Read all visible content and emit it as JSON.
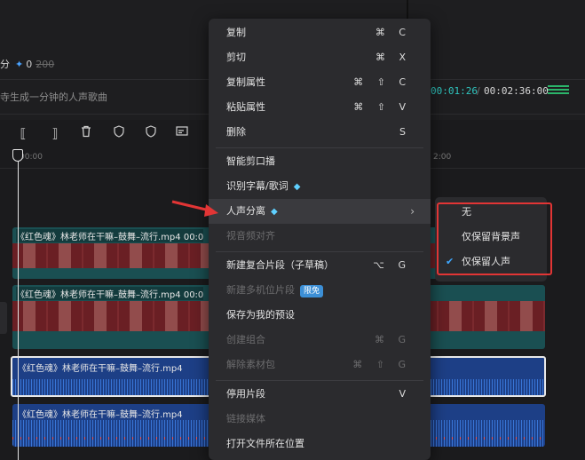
{
  "header": {
    "score_prefix": "分",
    "score_value": "0",
    "score_old": "200",
    "prompt_text": "寺生成一分钟的人声歌曲",
    "time_current": "00:01:26",
    "time_separator": "/",
    "time_total": "00:02:36:00"
  },
  "ruler": {
    "label_start": "00:00",
    "label_right": "2:00"
  },
  "tracks": {
    "video1_label": "《红色魂》林老师在干嘛–鼓舞–流行.mp4",
    "video1_time": "00:0",
    "video2_label": "《红色魂》林老师在干嘛–鼓舞–流行.mp4",
    "video2_time": "00:0",
    "audio1_label": "《红色魂》林老师在干嘛–鼓舞–流行.mp4",
    "audio2_label": "《红色魂》林老师在干嘛–鼓舞–流行.mp4"
  },
  "menu": {
    "items": [
      {
        "label": "复制",
        "shortcut": "⌘ C"
      },
      {
        "label": "剪切",
        "shortcut": "⌘ X"
      },
      {
        "label": "复制属性",
        "shortcut": "⌘ ⇧ C"
      },
      {
        "label": "粘贴属性",
        "shortcut": "⌘ ⇧ V"
      },
      {
        "label": "删除",
        "shortcut": "S"
      },
      {
        "label": "智能剪口播",
        "shortcut": ""
      },
      {
        "label": "识别字幕/歌词",
        "shortcut": ""
      },
      {
        "label": "人声分离",
        "shortcut": ""
      },
      {
        "label": "视音频对齐",
        "shortcut": ""
      },
      {
        "label": "新建复合片段（子草稿）",
        "shortcut": "⌥ G"
      },
      {
        "label": "新建多机位片段",
        "shortcut": "",
        "badge": "限免"
      },
      {
        "label": "保存为我的预设",
        "shortcut": ""
      },
      {
        "label": "创建组合",
        "shortcut": "⌘ G"
      },
      {
        "label": "解除素材包",
        "shortcut": "⌘ ⇧ G"
      },
      {
        "label": "停用片段",
        "shortcut": "V"
      },
      {
        "label": "链接媒体",
        "shortcut": ""
      },
      {
        "label": "打开文件所在位置",
        "shortcut": ""
      }
    ]
  },
  "submenu": {
    "items": [
      {
        "label": "无",
        "checked": false
      },
      {
        "label": "仅保留背景声",
        "checked": false
      },
      {
        "label": "仅保留人声",
        "checked": true
      }
    ],
    "check_mark": "✔"
  },
  "colors": {
    "accent": "#3ea7ff",
    "highlight": "#e23535",
    "teal": "#2fc7c0"
  }
}
